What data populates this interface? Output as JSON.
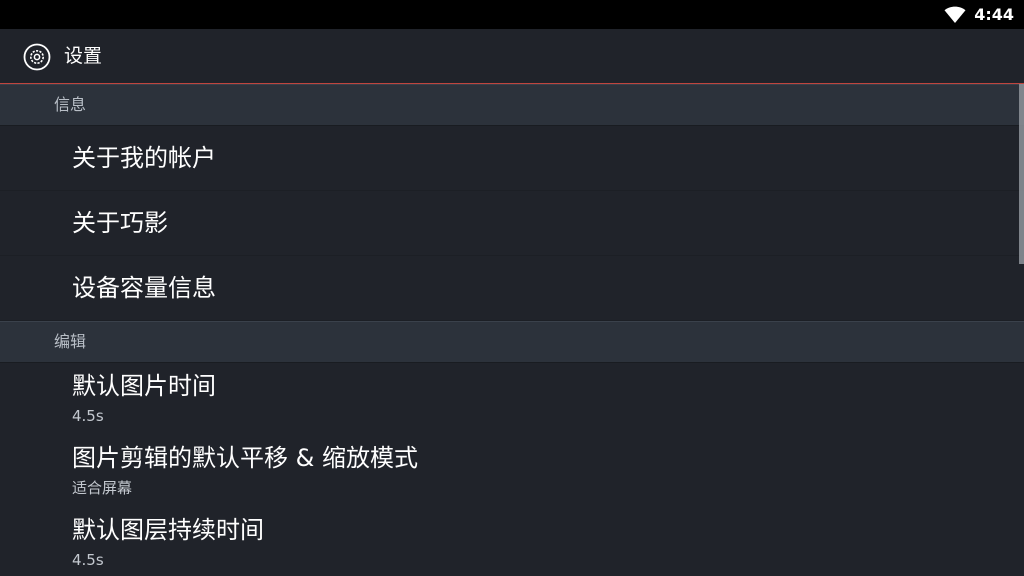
{
  "status_bar": {
    "time": "4:44",
    "icons": [
      "wifi-icon"
    ]
  },
  "action_bar": {
    "icon": "settings-icon",
    "title": "设置"
  },
  "sections": [
    {
      "header": "信息",
      "items": [
        {
          "title": "关于我的帐户"
        },
        {
          "title": "关于巧影"
        },
        {
          "title": "设备容量信息"
        }
      ]
    },
    {
      "header": "编辑",
      "items": [
        {
          "title": "默认图片时间",
          "summary": "4.5s"
        },
        {
          "title": "图片剪辑的默认平移 & 缩放模式",
          "summary": "适合屏幕"
        },
        {
          "title": "默认图层持续时间",
          "summary": "4.5s"
        }
      ]
    }
  ],
  "colors": {
    "background": "#20232a",
    "section_header": "#2c323b",
    "accent_line": "#c0453e",
    "status_bar": "#000000"
  }
}
